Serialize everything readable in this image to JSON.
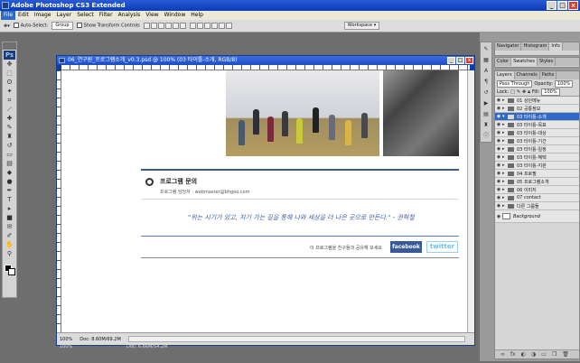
{
  "app": {
    "title": "Adobe Photoshop CS3 Extended",
    "logo_text": "Ps"
  },
  "window_controls": {
    "minimize": "_",
    "maximize": "□",
    "close": "x"
  },
  "menu": [
    "File",
    "Edit",
    "Image",
    "Layer",
    "Select",
    "Filter",
    "Analysis",
    "View",
    "Window",
    "Help"
  ],
  "options_bar": {
    "auto_select_label": "Auto-Select:",
    "auto_select_value": "Group",
    "show_transform_label": "Show Transform Controls",
    "workspace_label": "Workspace ▾"
  },
  "document": {
    "title": "06_연구원_프로그램소개_v0.3.psd @ 100% (03 타이틀-소개, RGB/8)",
    "zoom": "100%",
    "doc_size": "Doc: 8.60M/69.2M",
    "doc_size2": "Doc: 6.66M/54.2M"
  },
  "page": {
    "section_title": "프로그램 문의",
    "manager_text": "프로그램 담당자 : webmaster@bhgoo.com",
    "quote": "\"위는 시기가 있고, 자기 가는 길을 통해 나와 세상을 더 나은 곳으로 만든다.\" - 권혁철",
    "share_text": "이 프로그램을 친구들과 공유해 보세요",
    "facebook_label": "facebook",
    "twitter_label": "twitter"
  },
  "panels": {
    "top_tabs": [
      "Navigator",
      "Histogram",
      "Info"
    ],
    "color_tabs": [
      "Color",
      "Swatches",
      "Styles"
    ],
    "layer_tabs": [
      "Layers",
      "Channels",
      "Paths"
    ],
    "blend_mode": "Pass Through",
    "opacity_label": "Opacity:",
    "opacity_value": "100%",
    "lock_label": "Lock:",
    "fill_label": "Fill:",
    "fill_value": "100%",
    "layers": [
      {
        "name": "01 상단메뉴",
        "selected": false
      },
      {
        "name": "02 공통정보",
        "selected": false
      },
      {
        "name": "03 타이틀-소개",
        "selected": true
      },
      {
        "name": "03 타이틀-목표",
        "selected": false
      },
      {
        "name": "03 타이틀-대상",
        "selected": false
      },
      {
        "name": "03 타이틀-기간",
        "selected": false
      },
      {
        "name": "03 타이틀-일정",
        "selected": false
      },
      {
        "name": "03 타이틀-혜택",
        "selected": false
      },
      {
        "name": "03 타이틀-지원",
        "selected": false
      },
      {
        "name": "04 프로필",
        "selected": false
      },
      {
        "name": "05 프로그램소개",
        "selected": false
      },
      {
        "name": "06 이미지",
        "selected": false
      },
      {
        "name": "07 contact",
        "selected": false
      },
      {
        "name": "다른 그룹들",
        "selected": false
      }
    ],
    "background_layer": "Background"
  }
}
